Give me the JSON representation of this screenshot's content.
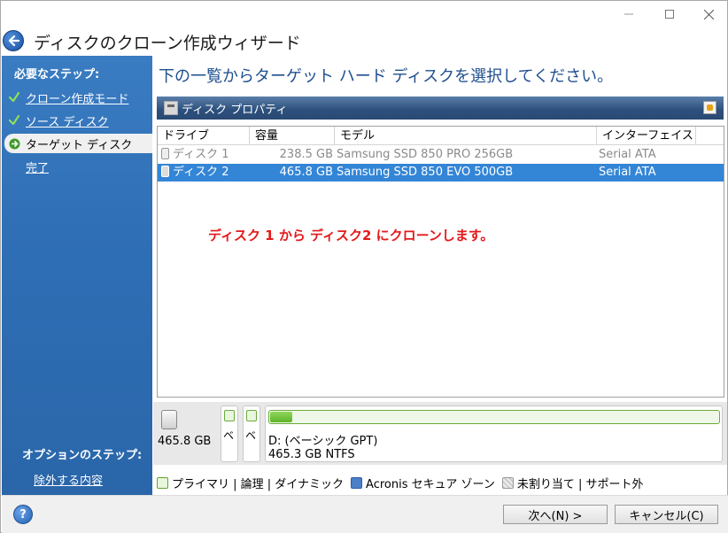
{
  "window": {
    "title": "ディスクのクローン作成ウィザード"
  },
  "sidebar": {
    "required_heading": "必要なステップ:",
    "items": [
      {
        "label": "クローン作成モード",
        "state": "done"
      },
      {
        "label": "ソース ディスク",
        "state": "done"
      },
      {
        "label": "ターゲット ディスク",
        "state": "current"
      },
      {
        "label": "完了",
        "state": "pending"
      }
    ],
    "optional_heading": "オプションのステップ:",
    "optional_items": [
      {
        "label": "除外する内容"
      }
    ]
  },
  "main": {
    "instruction": "下の一覧からターゲット ハード ディスクを選択してください。",
    "properties_label": "ディスク プロパティ",
    "columns": [
      "ドライブ",
      "容量",
      "モデル",
      "インターフェイス"
    ],
    "rows": [
      {
        "drive": "ディスク 1",
        "capacity": "238.5 GB",
        "model": "Samsung SSD 850 PRO 256GB",
        "interface": "Serial ATA",
        "state": "disabled"
      },
      {
        "drive": "ディスク 2",
        "capacity": "465.8 GB",
        "model": "Samsung SSD 850 EVO 500GB",
        "interface": "Serial ATA",
        "state": "selected"
      }
    ],
    "annotation": "ディスク 1 から ディスク2 にクローンします。"
  },
  "diskmap": {
    "disk_size": "465.8 GB",
    "mini_partitions": [
      "ベ",
      "ベ"
    ],
    "partition_label": "D: (ベーシック GPT)",
    "partition_detail": "465.3 GB  NTFS",
    "usage_fraction": 0.05
  },
  "legend": {
    "items": [
      {
        "label": "プライマリ | 論理 | ダイナミック",
        "swatch": "green"
      },
      {
        "label": "Acronis セキュア ゾーン",
        "swatch": "blue"
      },
      {
        "label": "未割り当て | サポート外",
        "swatch": "gray"
      }
    ]
  },
  "footer": {
    "help": "?",
    "next_label": "次へ(N) >",
    "cancel_label": "キャンセル(C)"
  },
  "colors": {
    "sidebar": "#2f6fb6",
    "selected_row": "#3385d6",
    "annotation": "#e4191b",
    "title_text": "#1f4f8f"
  }
}
